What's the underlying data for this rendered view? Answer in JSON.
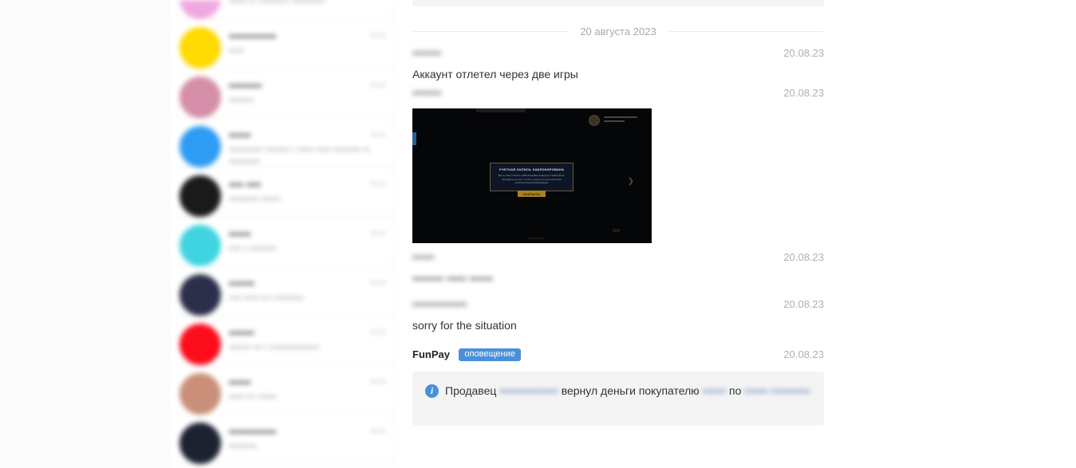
{
  "sidebar": {
    "items": [
      {
        "name": "•••••••",
        "preview": "•••••• •• ••••••••••  •••••••••••",
        "time": "••.••",
        "avatar_color": "#f0a8e0"
      },
      {
        "name": "•••••••••••••",
        "preview": "•••••",
        "time": "••.••",
        "avatar_color": "#ffd900"
      },
      {
        "name": "•••••••••",
        "preview": "••••••••",
        "time": "••.••",
        "avatar_color": "#d58fa8"
      },
      {
        "name": "••••••",
        "preview": "••••••••••• •••••••• • •••••\n••••• ••••••••• •• ••••••••••",
        "time": "••.••",
        "avatar_color": "#2f9cf4"
      },
      {
        "name": "•••• ••••",
        "preview": "•••••••••• ••••••",
        "time": "••.••",
        "avatar_color": "#1a1a1a"
      },
      {
        "name": "••••••",
        "preview": "•••• • •••••••••",
        "time": "••.••",
        "avatar_color": "#3fd4e0"
      },
      {
        "name": "•••••••",
        "preview": "•••• ••••• ••• ••••••••••",
        "time": "••.••",
        "avatar_color": "#2b2f4a"
      },
      {
        "name": "•••••••",
        "preview": "••••••• ••• • ••••••••••••••••",
        "time": "••.••",
        "avatar_color": "#fb0d1b"
      },
      {
        "name": "••••••",
        "preview": "•••••   ••• ••••••",
        "time": "••.••",
        "avatar_color": "#c98f78"
      },
      {
        "name": "•••••••••••••",
        "preview": "•••••••••",
        "time": "••.••",
        "avatar_color": "#1c2230"
      }
    ]
  },
  "conversation": {
    "date_separator": "20 августа 2023",
    "messages": [
      {
        "author": "••••••••",
        "author_blurred": true,
        "time": "20.08.23",
        "text": "Аккаунт отлетел через две игры",
        "text_blurred": false,
        "has_attachment": false
      },
      {
        "author": "••••••••",
        "author_blurred": true,
        "time": "20.08.23",
        "text": "",
        "text_blurred": false,
        "has_attachment": true
      },
      {
        "author": "••••••",
        "author_blurred": true,
        "time": "20.08.23",
        "text": "•••••••• ••••• ••••••",
        "text_blurred": true,
        "has_attachment": false
      },
      {
        "author": "•••••••••••••••",
        "author_blurred": true,
        "time": "20.08.23",
        "text": "sorry for the situation",
        "text_blurred": false,
        "has_attachment": false
      }
    ],
    "system_message": {
      "author": "FunPay",
      "badge": "оповещение",
      "time": "20.08.23",
      "icon": "info-icon",
      "text_prefix": "Продавец",
      "seller_redacted": "•••••••••••••••",
      "text_middle": "вернул деньги покупателю",
      "buyer_redacted": "••••••",
      "text_suffix": "по",
      "order_link_redacted": "•••••• ••••••••••"
    }
  },
  "attachment": {
    "title": "УЧЕТНАЯ ЗАПИСЬ ЗАБЛОКИРОВАНА",
    "body_line1": "Вы не смогли войти. Заблокировано навсегда. Пожалуйста, перейдите на",
    "body_link": "сайт службы поддержки",
    "body_line2": "для получения дополнительной",
    "body_line3": "информации",
    "button": "ЗАКРЫТЬ"
  },
  "colors": {
    "accent_blue": "#4a90d9",
    "badge_blue": "#4a90d9",
    "alert_bg": "#f4f4f4",
    "scrollbar": "#dcdcdc"
  }
}
